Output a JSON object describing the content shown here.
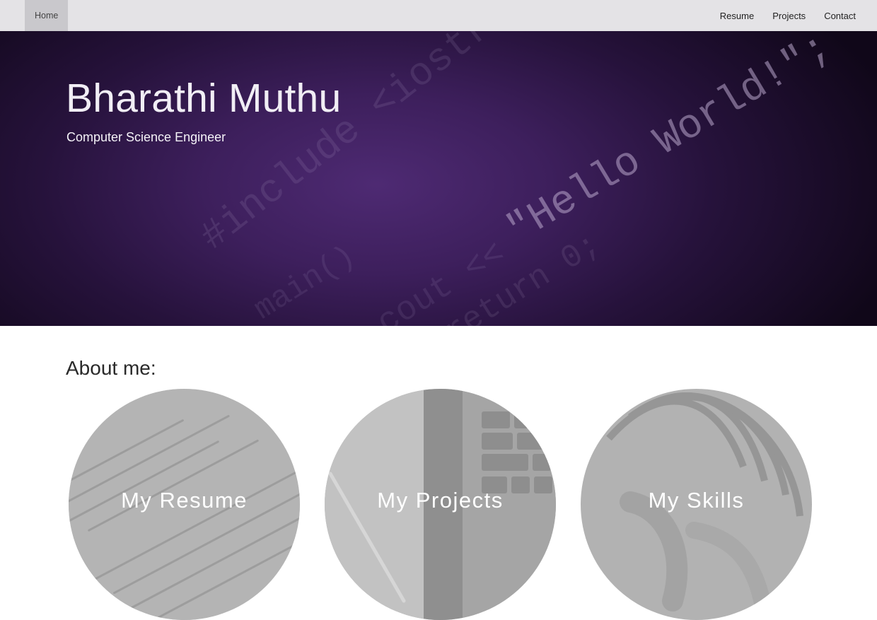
{
  "nav": {
    "home_label": "Home",
    "links": [
      "Resume",
      "Projects",
      "Contact"
    ]
  },
  "hero": {
    "title": "Bharathi Muthu",
    "subtitle": "Computer Science Engineer",
    "background_code": {
      "line_hello": "\"Hello World!\";",
      "line_include": "#include <iostream>",
      "line_main": "main()",
      "line_cout": "cout <<",
      "line_return": "return 0;"
    }
  },
  "about": {
    "heading": "About me:",
    "cards": [
      {
        "label": "My Resume"
      },
      {
        "label": "My Projects"
      },
      {
        "label": "My Skills"
      }
    ]
  },
  "colors": {
    "navbar_bg": "#e4e3e6",
    "nav_active_bg": "#c9c8cc",
    "hero_purple": "#4e2a73",
    "hero_dark": "#100719",
    "card_gray": "#a9a9a9"
  }
}
